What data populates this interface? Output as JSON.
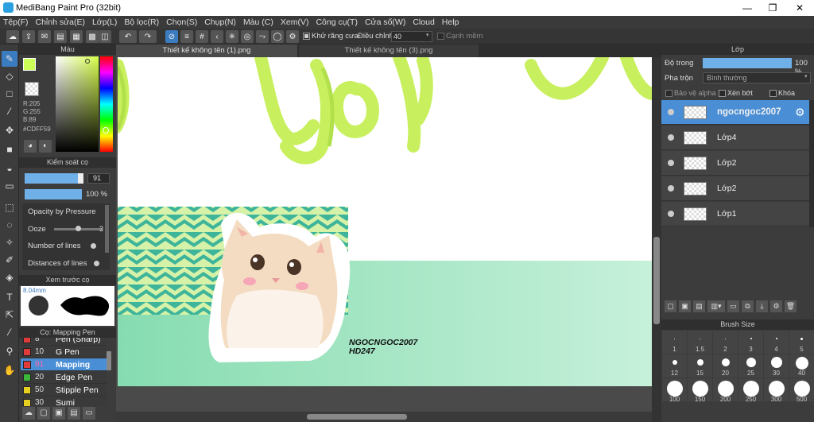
{
  "window": {
    "title": "MediBang Paint Pro (32bit)",
    "min": "—",
    "restore": "❐",
    "close": "✕"
  },
  "menu": [
    "Tệp(F)",
    "Chỉnh sửa(E)",
    "Lớp(L)",
    "Bộ lọc(R)",
    "Chọn(S)",
    "Chụp(N)",
    "Màu (C)",
    "Xem(V)",
    "Công cụ(T)",
    "Cửa số(W)",
    "Cloud",
    "Help"
  ],
  "toolbar": {
    "antialias_label": "Khử răng cưa",
    "adjust_label": "Điều chỉnh",
    "adjust_value": "40",
    "edge_label": "Cạnh mềm"
  },
  "color_panel": {
    "title": "Màu",
    "r": "R:205",
    "g": "G:255",
    "b": "B:89",
    "hex": "#CDFF59",
    "fg_color": "#CDFF59"
  },
  "brush_control": {
    "title": "Kiểm soát cọ",
    "size_value": "91",
    "opacity_value": "100 %",
    "size_fraction": 0.91,
    "opacity_fraction": 1.0,
    "options": [
      "Opacity by Pressure",
      "Ooze",
      "Number of lines",
      "Distances of lines"
    ],
    "ooze_value": "3"
  },
  "preview": {
    "title": "Xem trước cọ",
    "size_label": "8.04mm"
  },
  "brush_list": {
    "title": "Cọ: Mapping Pen",
    "items": [
      {
        "num": "8",
        "name": "Pen (Sharp)",
        "color": "#e03a3a"
      },
      {
        "num": "10",
        "name": "G Pen",
        "color": "#e03a3a"
      },
      {
        "num": "91",
        "name": "Mapping",
        "color": "#e03a3a",
        "selected": true
      },
      {
        "num": "20",
        "name": "Edge Pen",
        "color": "#3ab83a"
      },
      {
        "num": "50",
        "name": "Stipple Pen",
        "color": "#e8d020"
      },
      {
        "num": "30",
        "name": "Sumi",
        "color": "#e8d020"
      }
    ]
  },
  "tabs": [
    "Thiết kế không tên (1).png",
    "Thiết kế không tên (3).png"
  ],
  "canvas": {
    "name_text": "NGOCNGOC2007",
    "sub_text": "HD247"
  },
  "layer_panel": {
    "title": "Lớp",
    "opacity_label": "Độ trong",
    "opacity_value": "100 %",
    "blend_label": "Pha trộn",
    "blend_value": "Bình thường",
    "protect_alpha": "Bảo vệ alpha",
    "clip": "Xén bớt",
    "lock": "Khóa",
    "layers": [
      {
        "name": "ngocngoc2007",
        "selected": true
      },
      {
        "name": "Lớp4"
      },
      {
        "name": "Lớp2"
      },
      {
        "name": "Lớp2"
      },
      {
        "name": "Lớp1"
      }
    ]
  },
  "brush_size": {
    "title": "Brush Size",
    "row1": [
      "1",
      "1.5",
      "2",
      "3",
      "4",
      "5"
    ],
    "row2": [
      "12",
      "15",
      "20",
      "25",
      "30",
      "40"
    ],
    "row3": [
      "100",
      "150",
      "200",
      "250",
      "300",
      "500"
    ]
  }
}
